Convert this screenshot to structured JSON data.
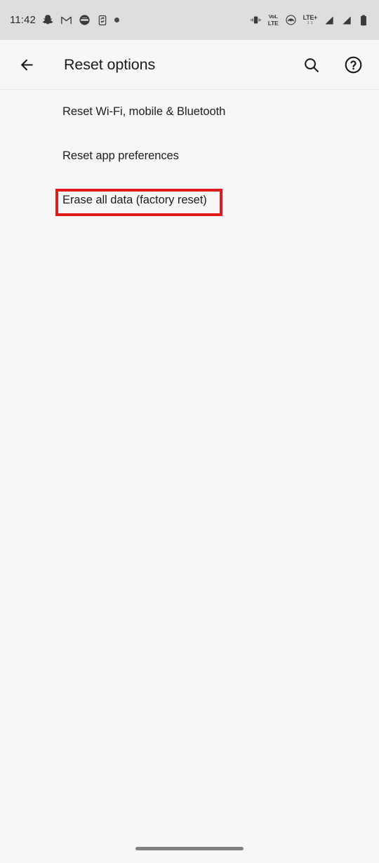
{
  "status_bar": {
    "time": "11:42",
    "left_icons": [
      {
        "name": "snapchat-icon",
        "label": "Snapchat"
      },
      {
        "name": "gmail-icon",
        "label": "Gmail"
      },
      {
        "name": "app-notification-icon",
        "label": "App notification"
      },
      {
        "name": "phone-sync-icon",
        "label": "Phone sync"
      },
      {
        "name": "more-notifications-dot-icon",
        "label": "More notifications"
      }
    ],
    "right_icons": [
      {
        "name": "vibrate-icon",
        "label": "Vibrate mode"
      },
      {
        "name": "volte-icon",
        "label": "VoLTE",
        "line1": "VoLTE",
        "line2": "LTE"
      },
      {
        "name": "wifi-calling-icon",
        "label": "Wi-Fi calling"
      },
      {
        "name": "lte-plus-icon",
        "label": "LTE+",
        "text": "LTE+",
        "subtext": "1 1"
      },
      {
        "name": "signal-sim1-icon",
        "label": "Signal SIM 1"
      },
      {
        "name": "signal-sim2-icon",
        "label": "Signal SIM 2"
      },
      {
        "name": "battery-icon",
        "label": "Battery"
      }
    ],
    "volte_line1": "VoL",
    "volte_line2": "LTE",
    "lte_text": "LTE+",
    "lte_sub": "1 1",
    "background_color": "#dedede"
  },
  "app_bar": {
    "back_label": "Back",
    "title": "Reset options",
    "search_label": "Search",
    "help_label": "Help",
    "background_color": "#f7f7f7"
  },
  "reset_list": {
    "items": [
      {
        "label": "Reset Wi-Fi, mobile & Bluetooth",
        "name": "reset-network-item",
        "highlighted": false
      },
      {
        "label": "Reset app preferences",
        "name": "reset-app-preferences-item",
        "highlighted": false
      },
      {
        "label": "Erase all data (factory reset)",
        "name": "erase-all-data-item",
        "highlighted": true
      }
    ]
  },
  "annotation": {
    "highlight_color": "#e01b1b",
    "target": "Erase all data (factory reset)"
  },
  "nav_bar": {
    "pill_label": "Home gesture bar",
    "pill_color": "#818181"
  }
}
